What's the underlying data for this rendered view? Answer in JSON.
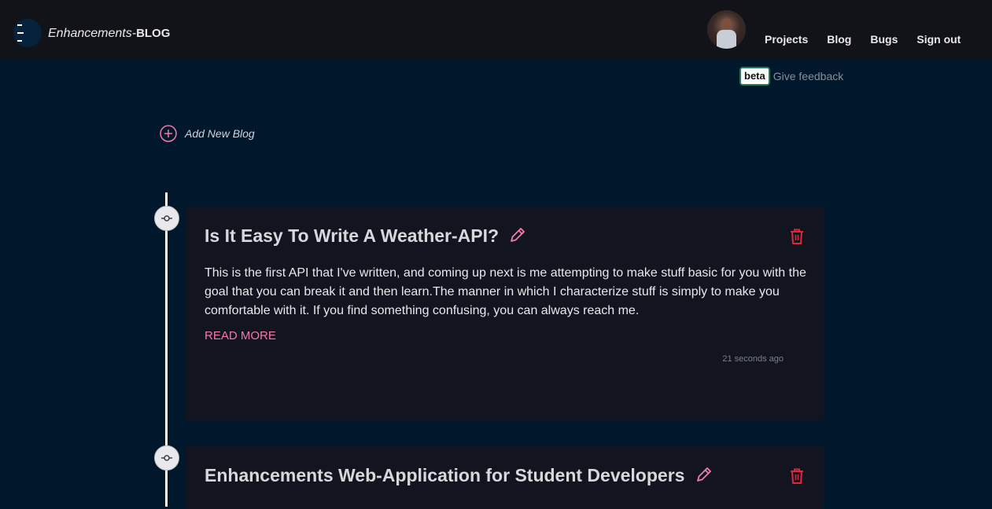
{
  "brand": {
    "name_italic": "Enhancements-",
    "name_bold": "BLOG"
  },
  "nav": {
    "projects": "Projects",
    "blog": "Blog",
    "bugs": "Bugs",
    "sign_out": "Sign out"
  },
  "feedback": {
    "badge": "beta",
    "text": "Give feedback"
  },
  "add_blog": {
    "label": "Add New Blog",
    "icon": "plus-circle-icon"
  },
  "posts": [
    {
      "title": "Is It Easy To Write A Weather-API?",
      "body": "This is the first API that I've written, and coming up next is me attempting to make stuff basic for you with the goal that you can break it and then learn.The manner in which I characterize stuff is simply to make you comfortable with it. If you find something confusing, you can always reach me.",
      "read_more": "READ MORE",
      "timestamp": "21 seconds ago"
    },
    {
      "title": "Enhancements Web-Application for Student Developers"
    }
  ],
  "colors": {
    "background": "#01172b",
    "navbar": "#121318",
    "card": "#121520",
    "accent_pink": "#f47aa8",
    "delete_red": "#e0263a"
  },
  "icons": {
    "edit": "pencil-icon",
    "delete": "trash-icon",
    "timeline_node": "commit-icon"
  }
}
